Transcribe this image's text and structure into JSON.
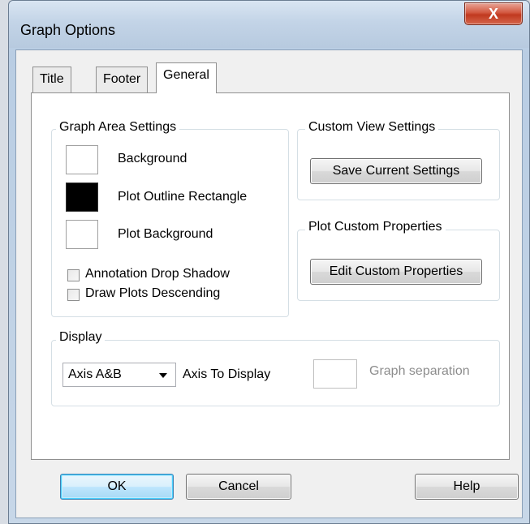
{
  "window": {
    "title": "Graph Options",
    "close_glyph": "X"
  },
  "tabs": [
    {
      "label": "Title",
      "active": false
    },
    {
      "label": "Footer",
      "active": false
    },
    {
      "label": "General",
      "active": true
    }
  ],
  "graph_area": {
    "legend": "Graph Area Settings",
    "background_label": "Background",
    "background_color": "#ffffff",
    "plot_outline_label": "Plot Outline Rectangle",
    "plot_outline_color": "#000000",
    "plot_background_label": "Plot Background",
    "plot_background_color": "#ffffff",
    "annotation_shadow_label": "Annotation Drop Shadow",
    "annotation_shadow_checked": false,
    "draw_descending_label": "Draw Plots Descending",
    "draw_descending_checked": false
  },
  "custom_view": {
    "legend": "Custom View Settings",
    "save_button": "Save Current Settings"
  },
  "plot_custom": {
    "legend": "Plot Custom Properties",
    "edit_button": "Edit Custom Properties"
  },
  "display": {
    "legend": "Display",
    "axis_select_value": "Axis A&B",
    "axis_label": "Axis To Display",
    "separation_label": "Graph separation",
    "separation_value": ""
  },
  "footer": {
    "ok": "OK",
    "cancel": "Cancel",
    "help": "Help"
  }
}
